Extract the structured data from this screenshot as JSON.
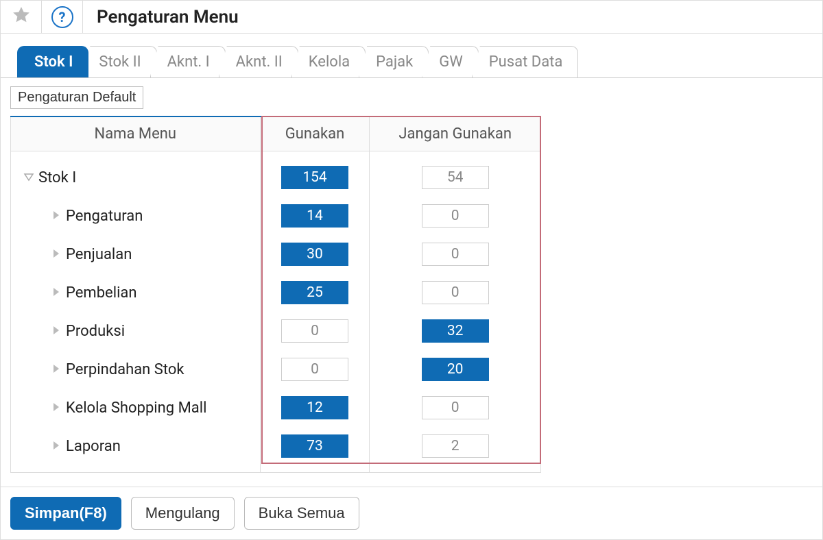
{
  "header": {
    "title": "Pengaturan Menu"
  },
  "tabs": [
    {
      "label": "Stok I",
      "active": true
    },
    {
      "label": "Stok II",
      "active": false
    },
    {
      "label": "Aknt. I",
      "active": false
    },
    {
      "label": "Aknt. II",
      "active": false
    },
    {
      "label": "Kelola",
      "active": false
    },
    {
      "label": "Pajak",
      "active": false
    },
    {
      "label": "GW",
      "active": false
    },
    {
      "label": "Pusat Data",
      "active": false
    }
  ],
  "buttons": {
    "defaults": "Pengaturan Default",
    "save": "Simpan(F8)",
    "repeat": "Mengulang",
    "open_all": "Buka Semua"
  },
  "table": {
    "columns": {
      "name": "Nama Menu",
      "use": "Gunakan",
      "nouse": "Jangan Gunakan"
    },
    "rows": [
      {
        "label": "Stok I",
        "level": 0,
        "expanded": true,
        "use": 154,
        "nouse": 54,
        "use_active": true,
        "nouse_active": false
      },
      {
        "label": "Pengaturan",
        "level": 1,
        "expanded": false,
        "use": 14,
        "nouse": 0,
        "use_active": true,
        "nouse_active": false
      },
      {
        "label": "Penjualan",
        "level": 1,
        "expanded": false,
        "use": 30,
        "nouse": 0,
        "use_active": true,
        "nouse_active": false
      },
      {
        "label": "Pembelian",
        "level": 1,
        "expanded": false,
        "use": 25,
        "nouse": 0,
        "use_active": true,
        "nouse_active": false
      },
      {
        "label": "Produksi",
        "level": 1,
        "expanded": false,
        "use": 0,
        "nouse": 32,
        "use_active": false,
        "nouse_active": true
      },
      {
        "label": "Perpindahan Stok",
        "level": 1,
        "expanded": false,
        "use": 0,
        "nouse": 20,
        "use_active": false,
        "nouse_active": true
      },
      {
        "label": "Kelola Shopping Mall",
        "level": 1,
        "expanded": false,
        "use": 12,
        "nouse": 0,
        "use_active": true,
        "nouse_active": false
      },
      {
        "label": "Laporan",
        "level": 1,
        "expanded": false,
        "use": 73,
        "nouse": 2,
        "use_active": true,
        "nouse_active": false
      }
    ]
  }
}
